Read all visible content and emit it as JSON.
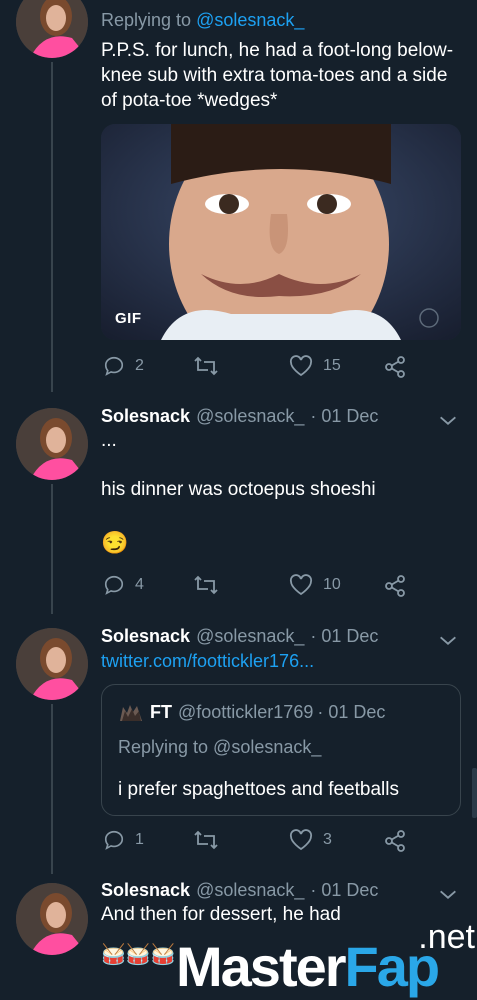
{
  "tweets": [
    {
      "reply_prefix": "Replying to",
      "reply_handle": "@solesnack_",
      "text": "P.P.S. for lunch, he had a foot-long below-knee sub with extra toma-toes and a side of pota-toe *wedges*",
      "media_badge": "GIF",
      "reply_count": "2",
      "retweet_count": "",
      "like_count": "15"
    },
    {
      "name": "Solesnack",
      "handle": "@solesnack_",
      "date": "· 01 Dec",
      "line1": "...",
      "line2": "his dinner was octoepus shoeshi",
      "emoji": "😏",
      "reply_count": "4",
      "like_count": "10"
    },
    {
      "name": "Solesnack",
      "handle": "@solesnack_",
      "date": "· 01 Dec",
      "link": "twitter.com/foottickler176...",
      "quote": {
        "name": "FT",
        "handle": "@foottickler1769",
        "date": "· 01 Dec",
        "reply_prefix": "Replying to @solesnack_",
        "text": "i prefer spaghettoes and feetballs"
      },
      "reply_count": "1",
      "like_count": "3"
    },
    {
      "name": "Solesnack",
      "handle": "@solesnack_",
      "date": "· 01 Dec",
      "text": "And then for dessert, he had",
      "emoji": "🥁🥁🥁"
    }
  ],
  "watermark": {
    "part1": "Master",
    "part2": "Fap",
    "suffix": ".net"
  },
  "colors": {
    "background": "#15202b",
    "secondary_text": "#8899a6",
    "link": "#1da1f2",
    "border": "#38444d"
  }
}
